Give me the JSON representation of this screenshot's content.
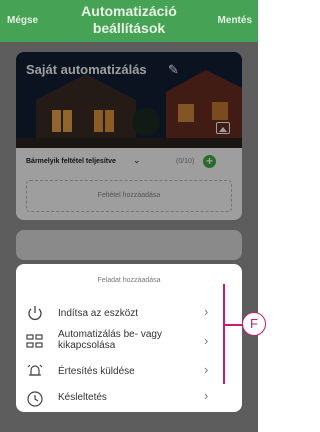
{
  "header": {
    "cancel_label": "Mégse",
    "title": "Automatizáció beállítások",
    "save_label": "Mentés"
  },
  "automation": {
    "name": "Saját automatizálás",
    "condition_label": "Bármelyik feltétel teljesítve",
    "condition_count": "(0/10)",
    "add_condition_label": "Feltétel hozzáadása"
  },
  "task_sheet": {
    "title": "Feladat hozzáadása",
    "items": [
      {
        "label": "Indítsa az eszközt",
        "icon": "power-icon"
      },
      {
        "label": "Automatizálás be- vagy kikapcsolása",
        "icon": "automation-toggle-icon"
      },
      {
        "label": "Értesítés küldése",
        "icon": "alarm-bell-icon"
      },
      {
        "label": "Késleltetés",
        "icon": "clock-icon"
      }
    ]
  },
  "callout": {
    "letter": "F"
  },
  "colors": {
    "header_green": "#46a255",
    "add_green": "#3faf4a",
    "callout_magenta": "#c81d6e"
  }
}
